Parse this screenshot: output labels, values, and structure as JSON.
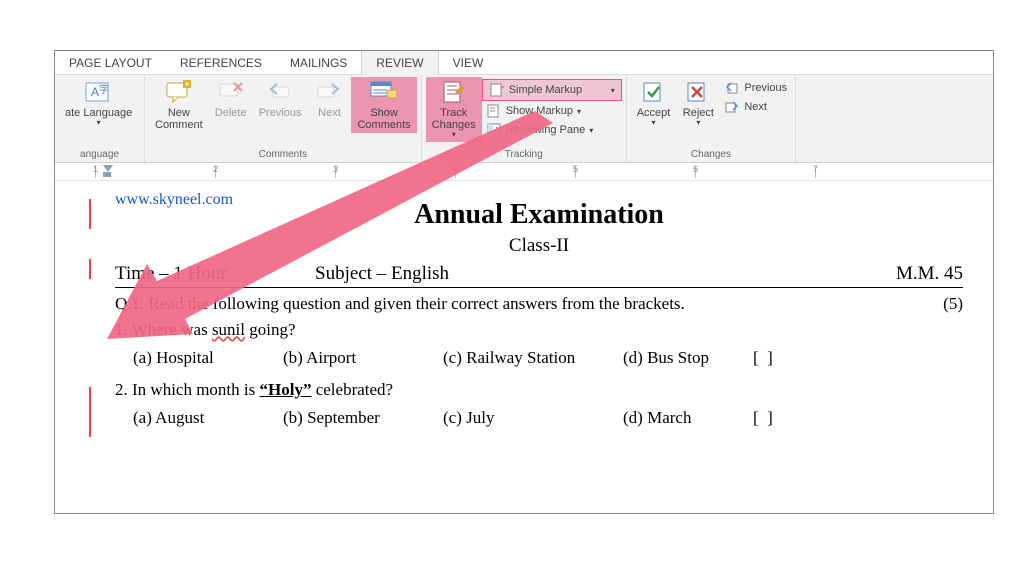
{
  "tabs": {
    "page_layout": "PAGE LAYOUT",
    "references": "REFERENCES",
    "mailings": "MAILINGS",
    "review": "REVIEW",
    "view": "VIEW"
  },
  "ribbon": {
    "lang_group": {
      "ate_language": "ate Language",
      "label": "anguage"
    },
    "comments_group": {
      "new_comment": "New\nComment",
      "delete": "Delete",
      "previous": "Previous",
      "next": "Next",
      "show_comments": "Show\nComments",
      "label": "Comments"
    },
    "tracking_group": {
      "track_changes": "Track\nChanges",
      "simple_markup": "Simple Markup",
      "show_markup": "Show Markup",
      "reviewing_pane": "Reviewing Pane",
      "label": "Tracking"
    },
    "changes_group": {
      "accept": "Accept",
      "reject": "Reject",
      "previous": "Previous",
      "next": "Next",
      "label": "Changes"
    }
  },
  "ruler": [
    "1",
    "2",
    "3",
    "4",
    "5",
    "6",
    "7"
  ],
  "doc": {
    "watermark": "www.skyneel.com",
    "title": "Annual Examination",
    "subtitle": "Class-II",
    "time": "Time – 1 Hour",
    "subject": "Subject – English",
    "mm": "M.M. 45",
    "q1": "Q.1. Read the following question and given their correct answers from the brackets.",
    "q1_marks": "(5)",
    "q1_1_pre": "1. Where was ",
    "q1_1_wavy": "sunil",
    "q1_1_post": " going?",
    "q1_1_a": "(a) Hospital",
    "q1_1_b": "(b) Airport",
    "q1_1_c": "(c) Railway Station",
    "q1_1_d": "(d) Bus Stop",
    "box": "[  ]",
    "q1_2_pre": "2. In which month is ",
    "q1_2_bold": "“Holy”",
    "q1_2_post": " celebrated?",
    "q1_2_a": "(a) August",
    "q1_2_b": "(b) September",
    "q1_2_c": "(c) July",
    "q1_2_d": "(d) March"
  }
}
